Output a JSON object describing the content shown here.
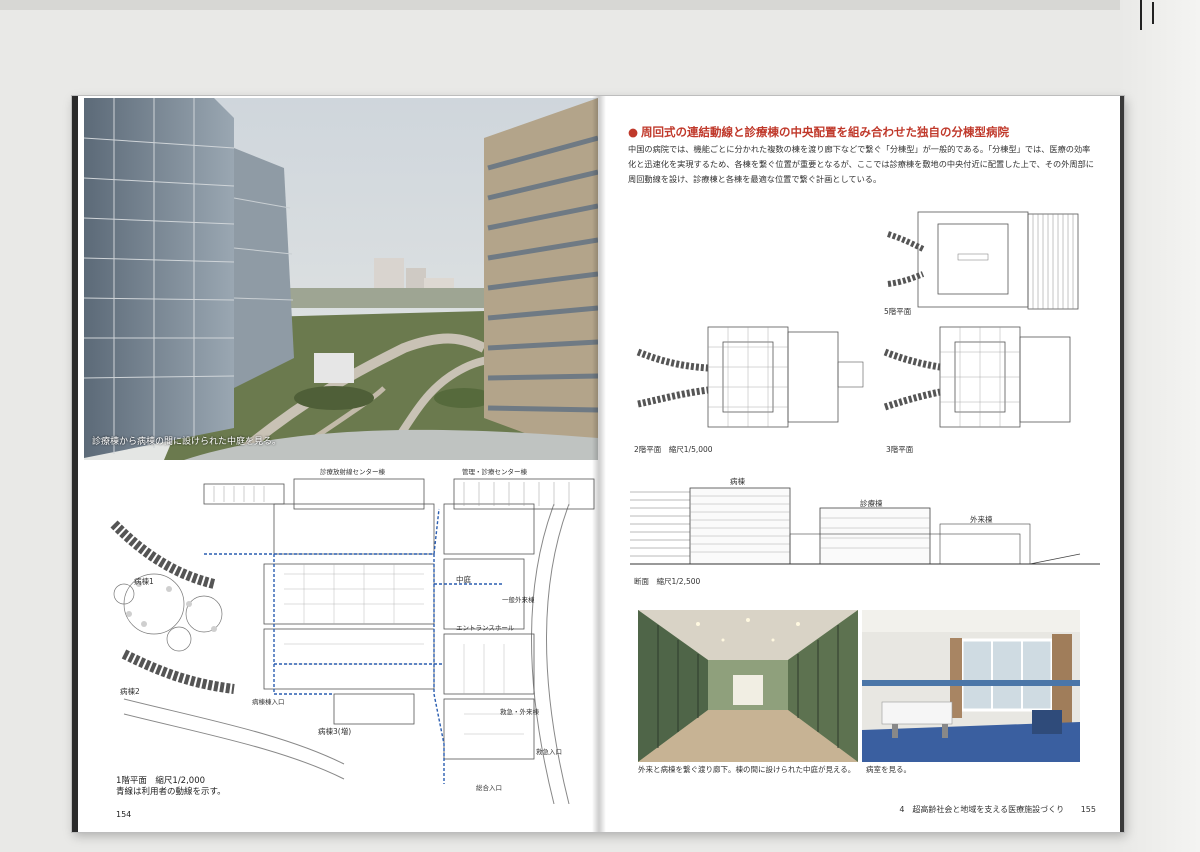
{
  "left_page": {
    "photo_caption": "診療棟から病棟の間に設けられた中庭を見る。",
    "plan_caption_line1": "1階平面　縮尺1/2,000",
    "plan_caption_line2": "青線は利用者の動線を示す。",
    "page_number": "154",
    "plan_labels": {
      "ward_left": "病棟1",
      "ward_left2": "病棟2",
      "ward_bottom": "病棟3(増)",
      "center_top": "診療放射線センター棟",
      "admin_top": "管理・診療センター棟",
      "courtyard": "中庭",
      "entrance_hall": "エントランスホール",
      "emergency": "救急・外来棟",
      "outpatient": "一般外来棟",
      "entry_main": "総合入口",
      "entry_ward": "病棟棟入口",
      "entry_emergency": "救急入口"
    }
  },
  "right_page": {
    "heading": "周回式の連結動線と診療棟の中央配置を組み合わせた独自の分棟型病院",
    "body": "中国の病院では、機能ごとに分かれた複数の棟を渡り廊下などで繋ぐ「分棟型」が一般的である。「分棟型」では、医療の効率化と迅速化を実現するため、各棟を繋ぐ位置が重要となるが、ここでは診療棟を敷地の中央付近に配置した上で、その外周部に周回動線を設け、診療棟と各棟を最適な位置で繋ぐ計画としている。",
    "plan_5f_label": "5階平面",
    "plan_2f_label": "2階平面　縮尺1/5,000",
    "plan_3f_label": "3階平面",
    "section_label": "断面　縮尺1/2,500",
    "section_tags": {
      "ward": "病棟",
      "clinic": "診療棟",
      "outpatient": "外来棟"
    },
    "corridor_caption": "外来と病棟を繋ぐ渡り廊下。棟の間に設けられた中庭が見える。",
    "room_caption": "病室を見る。",
    "footer": "4　超高齢社会と地域を支える医療施設づくり",
    "page_number": "155"
  },
  "colors": {
    "heading_red": "#c0392b",
    "route_blue": "#2a5db0"
  }
}
